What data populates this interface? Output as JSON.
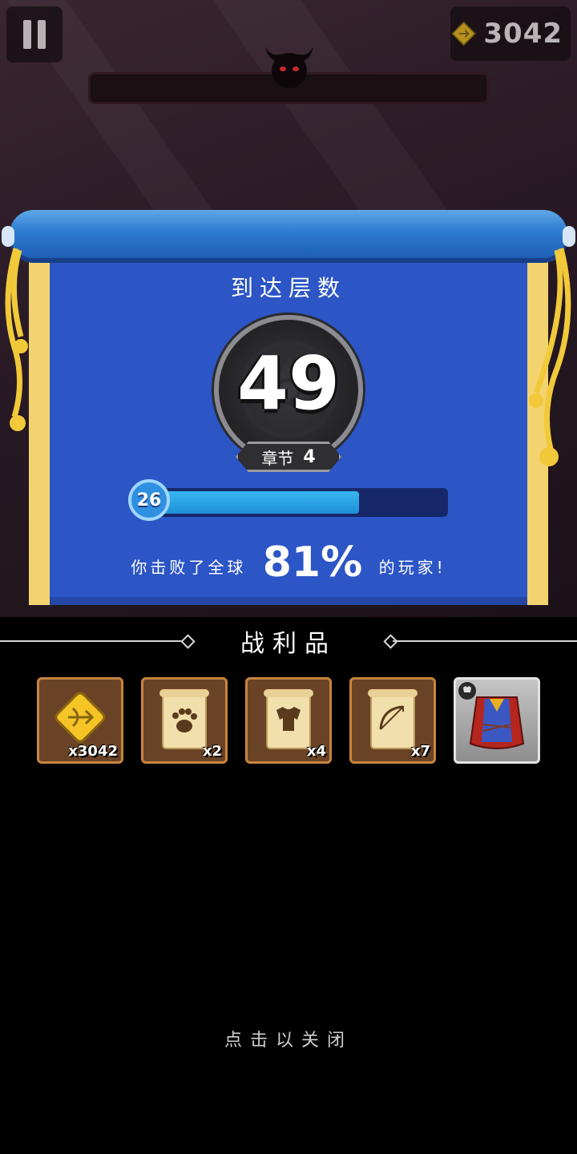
{
  "hud": {
    "currency_amount": "3042",
    "currency_icon": "bow-coin-icon"
  },
  "result_panel": {
    "title": "到达层数",
    "floor": "49",
    "chapter_label": "章节",
    "chapter_number": "4",
    "player_level": "26",
    "level_progress": 0.7,
    "beat_prefix": "你击败了全球",
    "beat_percent": "81%",
    "beat_suffix": "的玩家!"
  },
  "loot": {
    "title": "战利品",
    "items": [
      {
        "icon": "bow-coin-icon",
        "qty": "x3042"
      },
      {
        "icon": "paw-scroll-icon",
        "qty": "x2"
      },
      {
        "icon": "armor-scroll-icon",
        "qty": "x4"
      },
      {
        "icon": "bow-scroll-icon",
        "qty": "x7"
      },
      {
        "icon": "cape-armor-icon",
        "qty": ""
      }
    ]
  },
  "close_hint": "点击以关闭",
  "colors": {
    "panel_blue": "#2c55c6",
    "scroll_trim": "#f3d36f",
    "progress_fill": "#37b8f0",
    "loot_border": "#c8843f"
  }
}
